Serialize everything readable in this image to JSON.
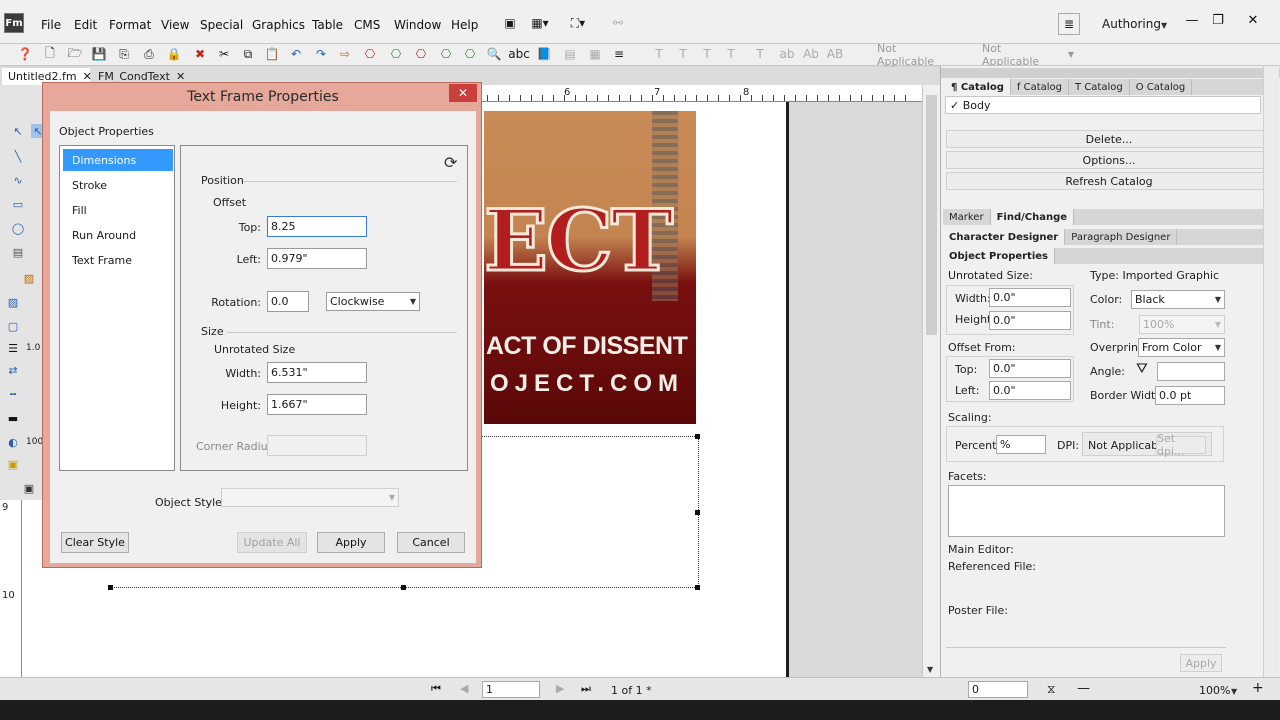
{
  "app": {
    "logo": "Fm",
    "workspace": "Authoring"
  },
  "menu": [
    "File",
    "Edit",
    "Format",
    "View",
    "Special",
    "Graphics",
    "Table",
    "CMS",
    "Window",
    "Help"
  ],
  "toolbar": {
    "dropdown1": "Not Applicable",
    "dropdown2": "Not Applicable",
    "text_tools": [
      "T",
      "T",
      "T",
      "T",
      "T",
      "ab",
      "Ab",
      "AB"
    ]
  },
  "tabs": [
    {
      "label": "Untitled2.fm"
    },
    {
      "label": "FM_CondText"
    }
  ],
  "ruler": {
    "h": [
      "6",
      "7",
      "8"
    ],
    "v": [
      "9",
      "10"
    ]
  },
  "poster": {
    "ect": "ECT",
    "line1": "ACT OF DISSENT",
    "line2": "OJECT.COM"
  },
  "dialog": {
    "title": "Text Frame Properties",
    "heading": "Object Properties",
    "list": [
      "Dimensions",
      "Stroke",
      "Fill",
      "Run Around",
      "Text Frame"
    ],
    "position_label": "Position",
    "offset_label": "Offset",
    "top_label": "Top:",
    "top_value": "8.25",
    "left_label": "Left:",
    "left_value": "0.979\"",
    "rotation_label": "Rotation:",
    "rotation_value": "0.0",
    "rotation_dir": "Clockwise",
    "size_label": "Size",
    "unrotated_label": "Unrotated Size",
    "width_label": "Width:",
    "width_value": "6.531\"",
    "height_label": "Height:",
    "height_value": "1.667\"",
    "corner_label": "Corner Radius:",
    "object_style_label": "Object Style:",
    "clear_style": "Clear Style",
    "update_all": "Update All",
    "apply": "Apply",
    "cancel": "Cancel"
  },
  "catalog": {
    "tabs": [
      "¶ Catalog",
      "f Catalog",
      "T Catalog",
      "O Catalog"
    ],
    "selected": "✓ Body",
    "delete": "Delete...",
    "options": "Options...",
    "refresh": "Refresh Catalog"
  },
  "panel2": {
    "tabs": [
      "Marker",
      "Find/Change"
    ],
    "tabs2": [
      "Character Designer",
      "Paragraph Designer"
    ],
    "tab3": "Object Properties"
  },
  "objprops": {
    "unrotated_size": "Unrotated Size:",
    "width_label": "Width:",
    "width": "0.0\"",
    "height_label": "Height:",
    "height": "0.0\"",
    "offset_from": "Offset From:",
    "top_label": "Top:",
    "top": "0.0\"",
    "left_label": "Left:",
    "left": "0.0\"",
    "type": "Type: Imported Graphic",
    "color_label": "Color:",
    "color": "Black",
    "tint_label": "Tint:",
    "tint": "100%",
    "overprint_label": "Overprint:",
    "overprint": "From Color",
    "angle_label": "Angle:",
    "border_label": "Border Width:",
    "border": "0.0 pt",
    "scaling": "Scaling:",
    "percent_label": "Percent:",
    "percent": "%",
    "dpi_label": "DPI:",
    "dpi": "Not Applicable",
    "set_dpi": "Set dpi...",
    "facets": "Facets:",
    "main_editor": "Main Editor:",
    "referenced_file": "Referenced File:",
    "poster_file": "Poster File:",
    "apply": "Apply"
  },
  "status": {
    "page_input": "1",
    "page_count": "1 of 1 *",
    "zoom_input": "0",
    "zoom": "100%"
  },
  "colors": {
    "accent": "#3399ff",
    "dialog_frame": "#e5a89a",
    "close": "#c9413a"
  }
}
